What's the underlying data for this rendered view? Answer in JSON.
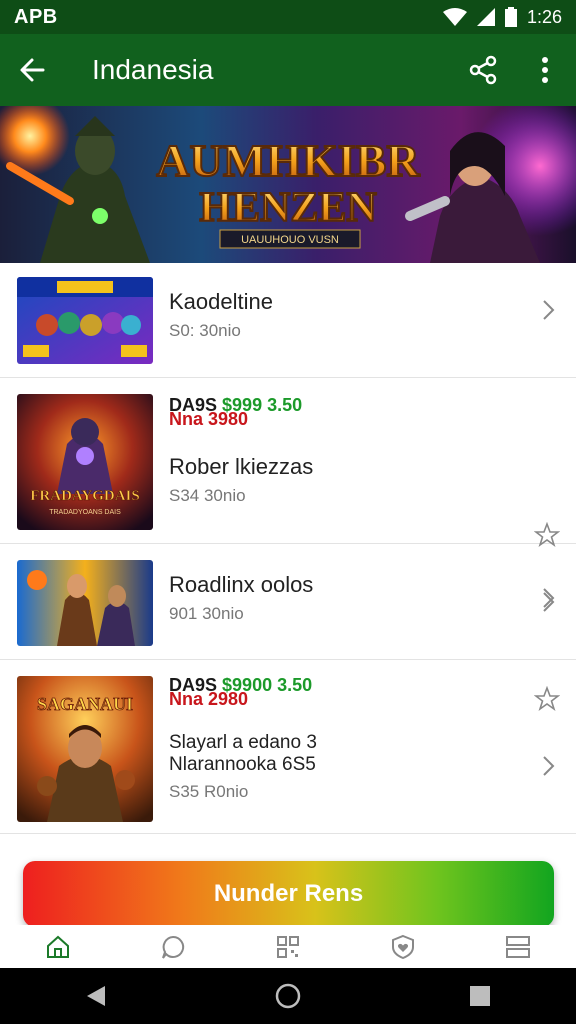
{
  "status_bar": {
    "carrier": "APB",
    "time": "1:26"
  },
  "app_bar": {
    "title": "Indanesia",
    "back_icon": "arrow-back-icon",
    "share_icon": "share-icon",
    "more_icon": "more-vert-icon"
  },
  "banner": {
    "title_line1": "AUMHKIBR",
    "title_line2": "HENZEN",
    "subtitle": "UAUUHOUO VUSN"
  },
  "list": {
    "items": [
      {
        "name": "Kaodeltine",
        "meta": "S0: 30nio",
        "has_star": false,
        "price_l1": "",
        "price_l2": ""
      },
      {
        "name": "Rober lkiezzas",
        "meta": "S34 30nio",
        "has_star": true,
        "price_l1_a": "DA9S",
        "price_l1_b": "$999",
        "price_l1_c": "3.50",
        "price_l2": "Nna 3980",
        "thumb_text": "FRADAYGDAIS",
        "thumb_sub": "TRADADYOANS DAIS"
      },
      {
        "name": "Roadlinx oolos",
        "meta": "901 30nio",
        "has_star": false
      },
      {
        "name_l1": "Slayarl a edano 3",
        "name_l2": "Nlarannooka 6S5",
        "meta": "S35 R0nio",
        "has_star": true,
        "price_l1_a": "DA9S",
        "price_l1_b": "$9900",
        "price_l1_c": "3.50",
        "price_l2": "Nna 2980",
        "thumb_text": "SAGANAUI"
      }
    ]
  },
  "cta": {
    "label": "Nunder Rens"
  },
  "bottom_nav": {
    "items": [
      "home-icon",
      "chat-icon",
      "qr-icon",
      "heart-shield-icon",
      "menu-icon"
    ]
  },
  "system_nav": {
    "items": [
      "back-triangle-icon",
      "home-circle-icon",
      "recents-square-icon"
    ]
  },
  "colors": {
    "appbar": "#11611e",
    "statusbar": "#0e4d16",
    "cta_start": "#ee1f1f",
    "cta_end": "#12a51f"
  }
}
